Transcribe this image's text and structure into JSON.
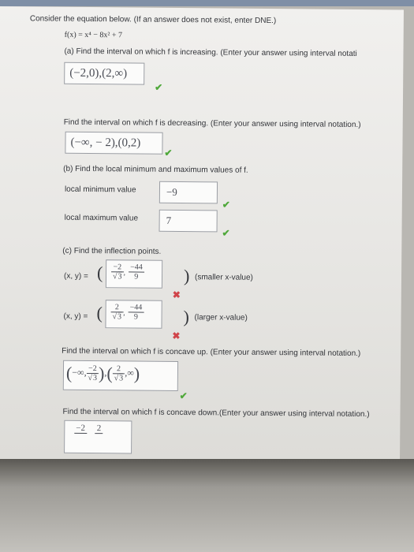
{
  "intro": "Consider the equation below. (If an answer does not exist, enter DNE.)",
  "equation": "f(x) = x⁴ − 8x² + 7",
  "part_a": {
    "prompt": "(a) Find the interval on which f is increasing. (Enter your answer using interval notati",
    "answer": "(−2,0),(2,∞)",
    "decreasing_prompt": "Find the interval on which f is decreasing. (Enter your answer using interval notation.)",
    "decreasing_answer": "(−∞, − 2),(0,2)"
  },
  "part_b": {
    "prompt": "(b) Find the local minimum and maximum values of f.",
    "min_label": "local minimum value",
    "min_answer": "−9",
    "max_label": "local maximum value",
    "max_answer": "7"
  },
  "part_c": {
    "prompt": "(c) Find the inflection points.",
    "xy_label": "(x, y) =",
    "point1": {
      "x_num": "−2",
      "x_den": "3",
      "y_num": "−44",
      "y_den": "9",
      "note": "(smaller x-value)"
    },
    "point2": {
      "x_num": "2",
      "x_den": "3",
      "y_num": "−44",
      "y_den": "9",
      "note": "(larger x-value)"
    },
    "concave_up_prompt": "Find the interval on which f is concave up. (Enter your answer using interval notation.)",
    "concave_up_answer": {
      "a": "−∞,",
      "b_num": "−2",
      "b_den": "3",
      "c_num": "2",
      "c_den": "3",
      "d": ",∞"
    },
    "concave_down_prompt": "Find the interval on which f is concave down.(Enter your answer using interval notation.)",
    "concave_down_partial": {
      "a": "−2",
      "b": "2"
    }
  },
  "marks": {
    "check": "✔",
    "cross": "✖"
  },
  "colors": {
    "check": "#4fa83a",
    "cross": "#d0444a"
  }
}
